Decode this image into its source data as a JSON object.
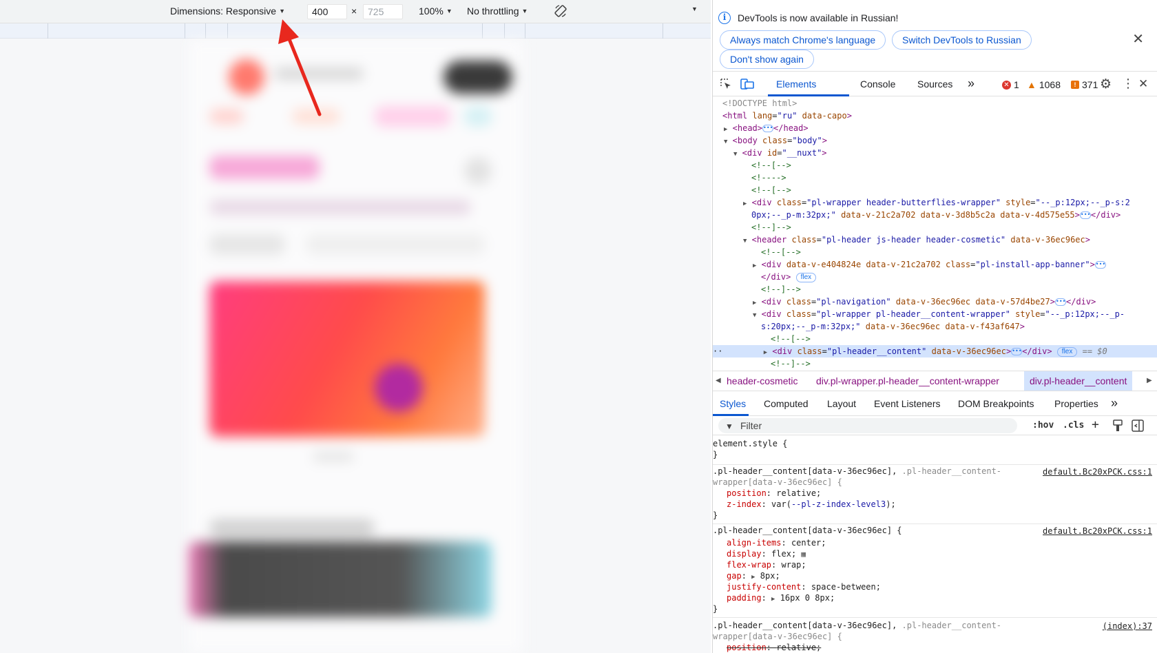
{
  "device_toolbar": {
    "dimensions_label": "Dimensions: Responsive",
    "width": "400",
    "times": "×",
    "height": "725",
    "zoom": "100%",
    "throttling": "No throttling"
  },
  "infobar": {
    "message": "DevTools is now available in Russian!",
    "btn_match": "Always match Chrome's language",
    "btn_switch": "Switch DevTools to Russian",
    "btn_dont_show": "Don't show again"
  },
  "main_tabs": {
    "elements": "Elements",
    "console": "Console",
    "sources": "Sources",
    "more": "»",
    "errors": "1",
    "warnings": "1068",
    "issues": "371"
  },
  "dom": {
    "l1": "<!DOCTYPE html>",
    "l2_tag": "html",
    "l2_attr1": "lang",
    "l2_val1": "\"ru\"",
    "l2_attr2": "data-capo",
    "l3_open": "<head>",
    "l3_close": "</head>",
    "l4_tag": "body",
    "l4_attr": "class",
    "l4_val": "\"body\"",
    "l5_tag": "div",
    "l5_attr": "id",
    "l5_val": "\"__nuxt\"",
    "c1": "<!--[-->",
    "c2": "<!---->",
    "c3": "<!--[-->",
    "l6_tag": "div",
    "l6_attr1": "class",
    "l6_val1": "\"pl-wrapper header-butterflies-wrapper\"",
    "l6_attr2": "style",
    "l6_val2": "\"--_p:12px;--_p-s:2",
    "l6b_val": "0px;--_p-m:32px;\"",
    "l6b_a1": "data-v-21c2a702",
    "l6b_a2": "data-v-3d8b5c2a",
    "l6b_a3": "data-v-4d575e55",
    "l6b_close": "</div>",
    "c4": "<!--]-->",
    "l7_tag": "header",
    "l7_attr": "class",
    "l7_val": "\"pl-header js-header header-cosmetic\"",
    "l7_a2": "data-v-36ec96ec",
    "c5": "<!--[-->",
    "l8_tag": "div",
    "l8_a1": "data-v-e404824e",
    "l8_a2": "data-v-21c2a702",
    "l8_attr": "class",
    "l8_val": "\"pl-install-app-banner\"",
    "l8b_close": "</div>",
    "flex1": "flex",
    "c6": "<!--]-->",
    "l9_tag": "div",
    "l9_attr": "class",
    "l9_val": "\"pl-navigation\"",
    "l9_a1": "data-v-36ec96ec",
    "l9_a2": "data-v-57d4be27",
    "l9_close": "</div>",
    "l10_tag": "div",
    "l10_attr1": "class",
    "l10_val1": "\"pl-wrapper pl-header__content-wrapper\"",
    "l10_attr2": "style",
    "l10_val2": "\"--_p:12px;--_p-",
    "l10b_val": "s:20px;--_p-m:32px;\"",
    "l10b_a1": "data-v-36ec96ec",
    "l10b_a2": "data-v-f43af647",
    "c7": "<!--[-->",
    "l11_tag": "div",
    "l11_attr": "class",
    "l11_val": "\"pl-header__content\"",
    "l11_a1": "data-v-36ec96ec",
    "l11_close": "</div>",
    "flex2": "flex",
    "l11_eq": "== $0",
    "c8": "<!--]-->"
  },
  "breadcrumbs": {
    "b1": "header-cosmetic",
    "b2": "div.pl-wrapper.pl-header__content-wrapper",
    "b3": "div.pl-header__content"
  },
  "styles_tabs": {
    "styles": "Styles",
    "computed": "Computed",
    "layout": "Layout",
    "event_listeners": "Event Listeners",
    "dom_breakpoints": "DOM Breakpoints",
    "properties": "Properties",
    "more": "»"
  },
  "filter": {
    "placeholder": "Filter",
    "hov": ":hov",
    "cls": ".cls"
  },
  "rules": {
    "r0_sel": "element.style {",
    "close": "}",
    "r1_sel": ".pl-header__content[data-v-36ec96ec],",
    "r1_sel2": " .pl-header__content-",
    "r1_sel3": "wrapper[data-v-36ec96ec] {",
    "r1_src": "default.Bc20xPCK.css:1",
    "r1_p1n": "position",
    "r1_p1v": "relative",
    "r1_p2n": "z-index",
    "r1_p2v": "var(",
    "r1_p2var": "--pl-z-index-level3",
    "r1_p2end": ")",
    "r2_sel": ".pl-header__content[data-v-36ec96ec] {",
    "r2_src": "default.Bc20xPCK.css:1",
    "r2_p1n": "align-items",
    "r2_p1v": "center",
    "r2_p2n": "display",
    "r2_p2v": "flex",
    "r2_p3n": "flex-wrap",
    "r2_p3v": "wrap",
    "r2_p4n": "gap",
    "r2_p4v": "8px",
    "r2_p5n": "justify-content",
    "r2_p5v": "space-between",
    "r2_p6n": "padding",
    "r2_p6v": "16px 0 8px",
    "r3_sel": ".pl-header__content[data-v-36ec96ec],",
    "r3_sel2": " .pl-header__content-",
    "r3_sel3": "wrapper[data-v-36ec96ec] {",
    "r3_src": "(index):37",
    "r3_p1n": "position",
    "r3_p1v": "relative"
  },
  "colors": {
    "accent": "#0b57d0",
    "arrow": "#e8281e",
    "error": "#dc362e",
    "warning": "#e37400"
  }
}
